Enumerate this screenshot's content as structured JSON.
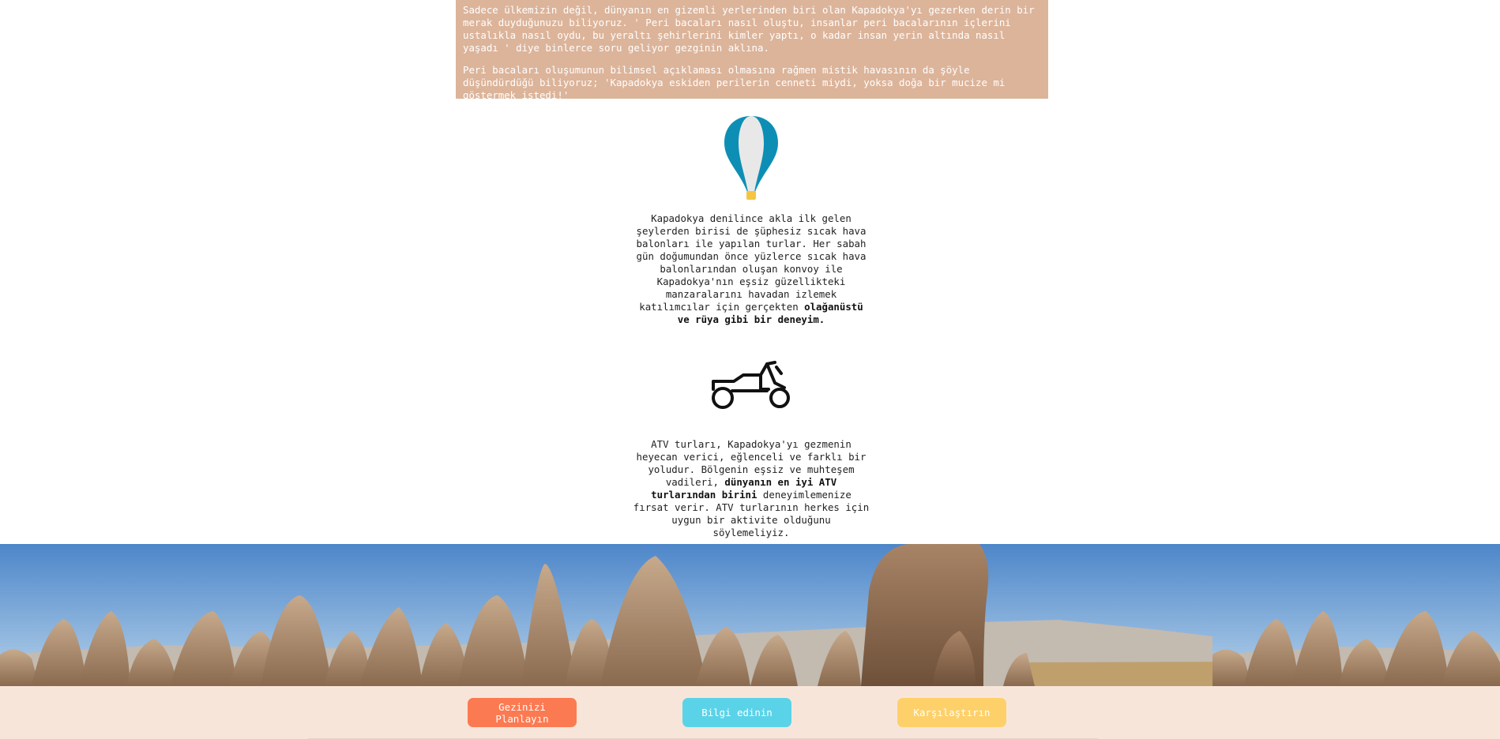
{
  "intro": {
    "paragraph1": "Sadece ülkemizin değil, dünyanın en gizemli yerlerinden biri olan Kapadokya'yı gezerken derin bir merak duyduğunuzu biliyoruz. ' Peri bacaları nasıl oluştu, insanlar peri bacalarının içlerini ustalıkla nasıl oydu, bu yeraltı şehirlerini kimler yaptı, o kadar insan yerin altında nasıl yaşadı ' diye binlerce soru geliyor gezginin aklına.",
    "paragraph2": "Peri bacaları oluşumunun bilimsel açıklaması olmasına rağmen mistik havasının da şöyle düşündürdüğü biliyoruz; 'Kapadokya eskiden perilerin cenneti miydi, yoksa doğa bir mucize mi göstermek istedi!'"
  },
  "balloon_feature": {
    "icon": "hot-air-balloon-icon",
    "text": "Kapadokya denilince akla ilk gelen şeylerden birisi de şüphesiz sıcak hava balonları ile yapılan turlar. Her sabah gün doğumundan önce yüzlerce sıcak hava balonlarından oluşan konvoy ile Kapadokya'nın eşsiz güzellikteki manzaralarını havadan izlemek katılımcılar için gerçekten ",
    "highlight": "olağanüstü ve rüya gibi bir deneyim."
  },
  "atv_feature": {
    "icon": "atv-icon",
    "text_before": "ATV turları, Kapadokya'yı gezmenin heyecan verici, eğlenceli ve farklı bir yoludur. Bölgenin eşsiz ve muhteşem vadileri, ",
    "highlight": "dünyanın en iyi ATV turlarından birini",
    "text_after": " deneyimlemenize fırsat verir. ATV turlarının herkes için uygun bir aktivite olduğunu söylemeliyiz."
  },
  "footer": {
    "plan_button": "Gezinizi Planlayın",
    "info_button": "Bilgi edinin",
    "compare_button": "Karşılaştırın"
  },
  "colors": {
    "intro_bg": "#dcb49a",
    "footer_bg": "#f8e5da",
    "plan_button": "#fc7a52",
    "info_button": "#5ad3e8",
    "compare_button": "#fdd06a",
    "balloon_blue": "#0d8fb5",
    "balloon_basket": "#f5c542"
  }
}
